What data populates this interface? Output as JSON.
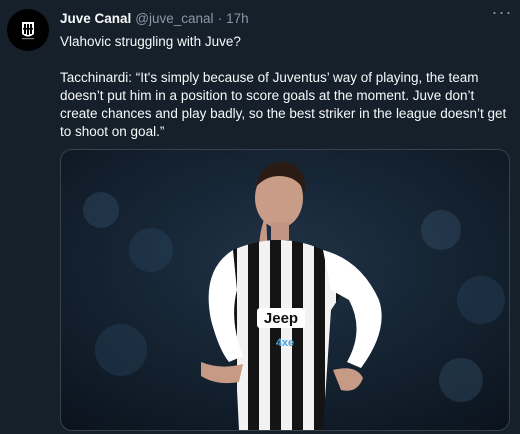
{
  "tweet": {
    "author_name": "Juve Canal",
    "handle": "@juve_canal",
    "separator": "·",
    "time": "17h",
    "more_icon": "more-horizontal-icon",
    "text_line1": "Vlahovic struggling with Juve?",
    "text_line2": "Tacchinardi: “It's simply because of Juventus’ way of playing, the team doesn’t put him in a position to score goals at the moment. Juve don’t create chances and play badly, so the best striker in the league doesn’t get to shoot on goal.”",
    "media": {
      "sponsor_text": "Jeep",
      "sponsor_sub": "4xe"
    }
  },
  "colors": {
    "background": "#15202b",
    "text_primary": "#f7f9f9",
    "text_secondary": "#8b98a5",
    "border": "#38444d"
  }
}
